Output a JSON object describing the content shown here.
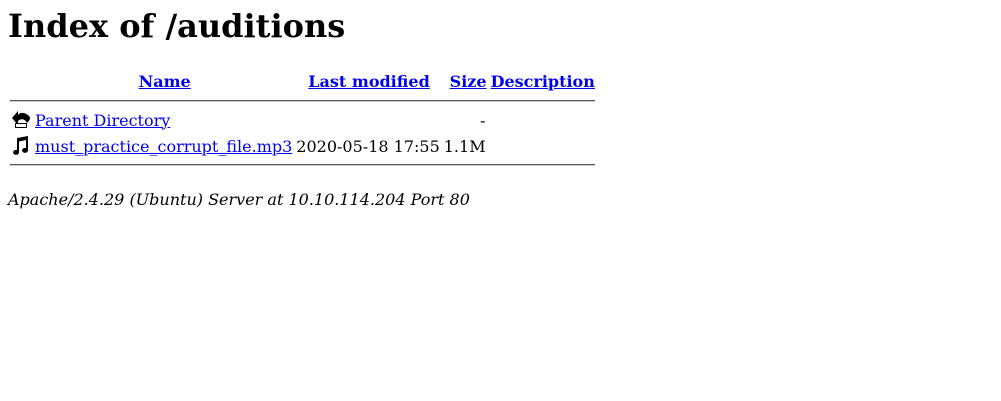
{
  "title": "Index of /auditions",
  "columns": {
    "name": "Name",
    "last_modified": "Last modified",
    "size": "Size",
    "description": "Description"
  },
  "rows": [
    {
      "icon": "back-arrow-icon",
      "name": "Parent Directory",
      "last_modified": "",
      "size": "-",
      "description": ""
    },
    {
      "icon": "music-note-icon",
      "name": "must_practice_corrupt_file.mp3",
      "last_modified": "2020-05-18 17:55",
      "size": "1.1M",
      "description": ""
    }
  ],
  "footer": "Apache/2.4.29 (Ubuntu) Server at 10.10.114.204 Port 80",
  "colors": {
    "link": "#0000ee",
    "text": "#000000",
    "background": "#ffffff"
  }
}
